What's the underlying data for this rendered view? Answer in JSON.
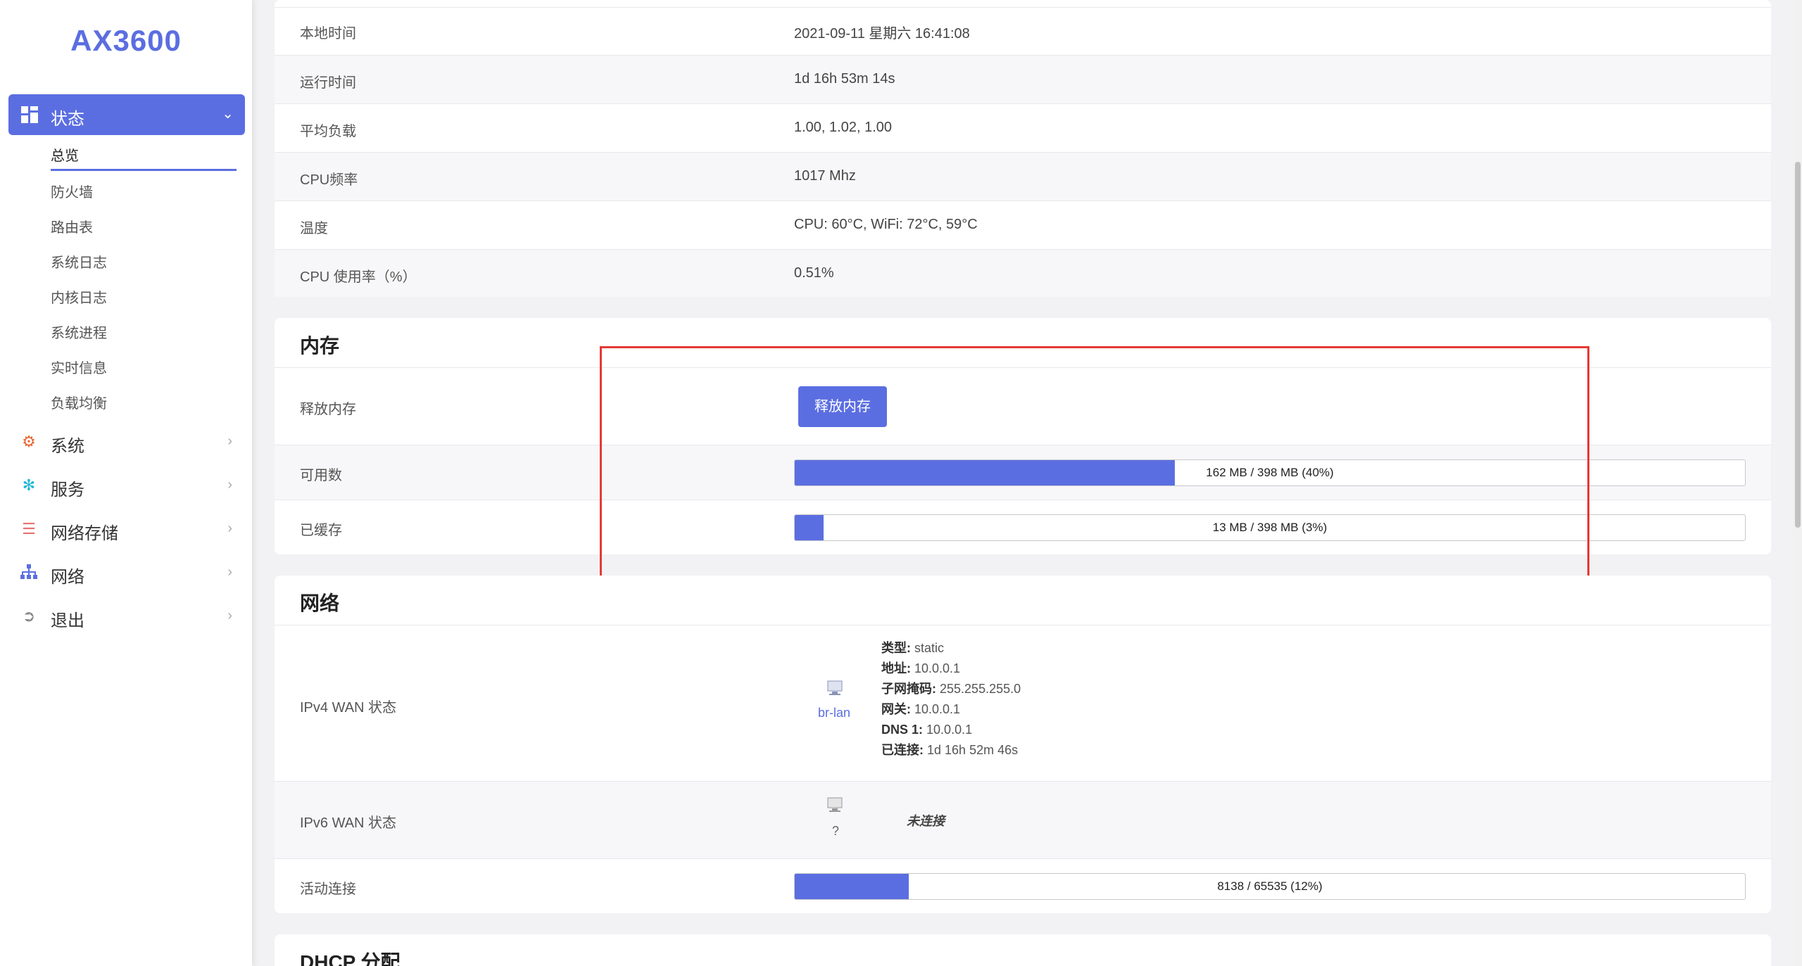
{
  "brand": "AX3600",
  "sidebar": {
    "active_menu": "状态",
    "submenu": [
      "总览",
      "防火墙",
      "路由表",
      "系统日志",
      "内核日志",
      "系统进程",
      "实时信息",
      "负载均衡"
    ],
    "menus": [
      {
        "label": "系统",
        "icon": "gear-icon"
      },
      {
        "label": "服务",
        "icon": "services-icon"
      },
      {
        "label": "网络存储",
        "icon": "database-icon"
      },
      {
        "label": "网络",
        "icon": "sitemap-icon"
      },
      {
        "label": "退出",
        "icon": "logout-icon"
      }
    ]
  },
  "system": {
    "rows": [
      {
        "key": "本地时间",
        "value": "2021-09-11 星期六 16:41:08"
      },
      {
        "key": "运行时间",
        "value": "1d 16h 53m 14s"
      },
      {
        "key": "平均负载",
        "value": "1.00, 1.02, 1.00"
      },
      {
        "key": "CPU频率",
        "value": "1017 Mhz"
      },
      {
        "key": "温度",
        "value": "CPU: 60°C, WiFi: 72°C, 59°C"
      },
      {
        "key": "CPU 使用率（%）",
        "value": "0.51%"
      }
    ]
  },
  "memory": {
    "title": "内存",
    "release_label": "释放内存",
    "release_button": "释放内存",
    "available_label": "可用数",
    "available_text": "162 MB / 398 MB (40%)",
    "available_fraction": 0.4,
    "cached_label": "已缓存",
    "cached_text": "13 MB / 398 MB (3%)",
    "cached_fraction": 0.03
  },
  "network": {
    "title": "网络",
    "ipv4_label": "IPv4 WAN 状态",
    "ipv4_iface": "br-lan",
    "ipv4_details": [
      {
        "k": "类型:",
        "v": "static"
      },
      {
        "k": "地址:",
        "v": "10.0.0.1"
      },
      {
        "k": "子网掩码:",
        "v": "255.255.255.0"
      },
      {
        "k": "网关:",
        "v": "10.0.0.1"
      },
      {
        "k": "DNS 1:",
        "v": "10.0.0.1"
      },
      {
        "k": "已连接:",
        "v": "1d 16h 52m 46s"
      }
    ],
    "ipv6_label": "IPv6 WAN 状态",
    "ipv6_iface": "?",
    "ipv6_status": "未连接",
    "conn_label": "活动连接",
    "conn_text": "8138 / 65535 (12%)",
    "conn_fraction": 0.12
  },
  "dhcp": {
    "title": "DHCP 分配"
  },
  "colors": {
    "accent": "#5b6ee1",
    "highlight": "#e53935"
  }
}
